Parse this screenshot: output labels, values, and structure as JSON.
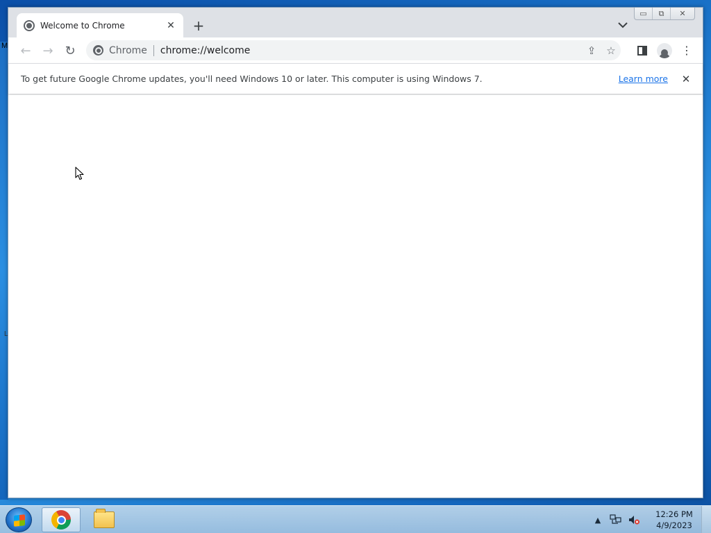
{
  "desktop": {
    "edge_glyph_top": "M",
    "edge_glyph_mid": "L"
  },
  "window": {
    "controls": {
      "minimize": "▭",
      "restore": "⧉",
      "close": "✕"
    }
  },
  "tabs": [
    {
      "title": "Welcome to Chrome",
      "close": "✕",
      "icon": "globe-icon"
    }
  ],
  "new_tab_label": "+",
  "tab_search_label": "⌄",
  "toolbar": {
    "back": "←",
    "forward": "→",
    "reload": "↻",
    "omnibox": {
      "chip_label": "Chrome",
      "url": "chrome://welcome",
      "share_icon": "⇪",
      "bookmark_icon": "☆"
    },
    "menu": "⋮"
  },
  "infobar": {
    "message": "To get future Google Chrome updates, you'll need Windows 10 or later. This computer is using Windows 7.",
    "link": "Learn more",
    "close": "✕"
  },
  "taskbar": {
    "apps": [
      {
        "name": "Google Chrome",
        "icon": "chrome-icon",
        "active": true
      },
      {
        "name": "Windows Explorer",
        "icon": "folder-icon",
        "active": false
      }
    ],
    "tray": {
      "show_hidden": "▲",
      "network_icon": "🖧",
      "volume_icon": "🔇"
    },
    "clock": {
      "time": "12:26 PM",
      "date": "4/9/2023"
    }
  },
  "colors": {
    "accent": "#1a73e8",
    "tab_strip": "#dee1e6",
    "omnibox_bg": "#f1f3f4"
  }
}
